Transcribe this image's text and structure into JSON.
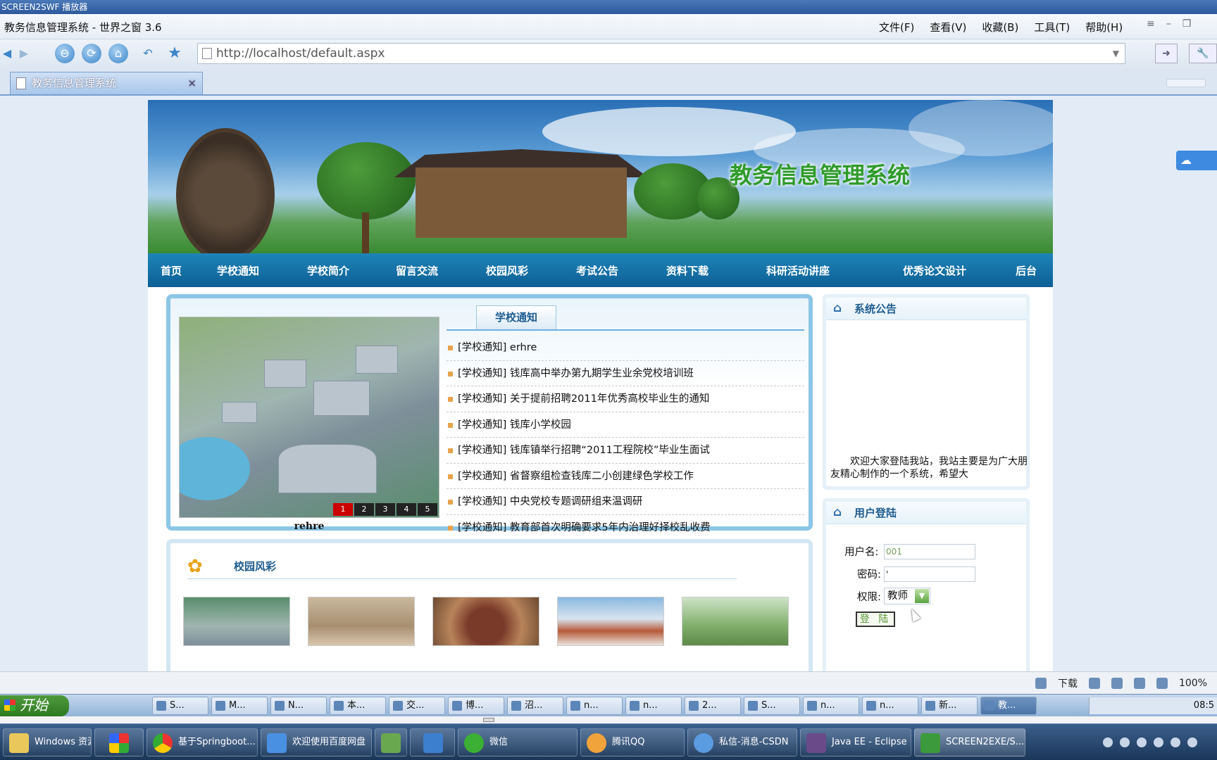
{
  "player": {
    "title": "SCREEN2SWF 播放器"
  },
  "browser": {
    "title": "教务信息管理系统 - 世界之窗 3.6",
    "menu": [
      "文件(F)",
      "查看(V)",
      "收藏(B)",
      "工具(T)",
      "帮助(H)"
    ],
    "address": "http://localhost/default.aspx",
    "tab_label": "教务信息管理系统",
    "tab_close": "×",
    "zoom": "100%",
    "download_label": "下载"
  },
  "site": {
    "banner_title": "教务信息管理系统",
    "nav": [
      "首页",
      "学校通知",
      "学校简介",
      "留言交流",
      "校园风彩",
      "考试公告",
      "资料下载",
      "科研活动讲座",
      "优秀论文设计",
      "后台"
    ],
    "slider": {
      "caption": "rehre",
      "pages": [
        "1",
        "2",
        "3",
        "4",
        "5"
      ],
      "active": "1"
    },
    "news": {
      "tab": "学校通知",
      "items": [
        "[学校通知] erhre",
        "[学校通知] 钱库高中举办第九期学生业余党校培训班",
        "[学校通知] 关于提前招聘2011年优秀高校毕业生的通知",
        "[学校通知] 钱库小学校园",
        "[学校通知] 钱库镇举行招聘“2011工程院校”毕业生面试",
        "[学校通知] 省督察组检查钱库二小创建绿色学校工作",
        "[学校通知] 中央党校专题调研组来温调研",
        "[学校通知] 教育部首次明确要求5年内治理好择校乱收费"
      ]
    },
    "campus": {
      "title": "校园风彩"
    },
    "announcement": {
      "title": "系统公告",
      "text": "欢迎大家登陆我站，我站主要是为广大朋友精心制作的一个系统，希望大"
    },
    "login": {
      "title": "用户登陆",
      "username_label": "用户名:",
      "username_value": "001",
      "password_label": "密码:",
      "password_value": "'",
      "role_label": "权限:",
      "role_value": "教师",
      "submit": "登 陆"
    }
  },
  "xp_taskbar": {
    "start": "开始",
    "items": [
      "S...",
      "M...",
      "N...",
      "本...",
      "交...",
      "博...",
      "沼...",
      "n...",
      "n...",
      "2...",
      "S...",
      "n...",
      "n...",
      "新...",
      "教..."
    ],
    "clock": "08:5"
  },
  "win_taskbar": {
    "items": [
      "Windows 资源...",
      "",
      "基于Springboot...",
      "欢迎使用百度网盘",
      "",
      "",
      "微信",
      "腾讯QQ",
      "私信-消息-CSDN",
      "Java EE - Eclipse",
      "SCREEN2EXE/S..."
    ]
  }
}
